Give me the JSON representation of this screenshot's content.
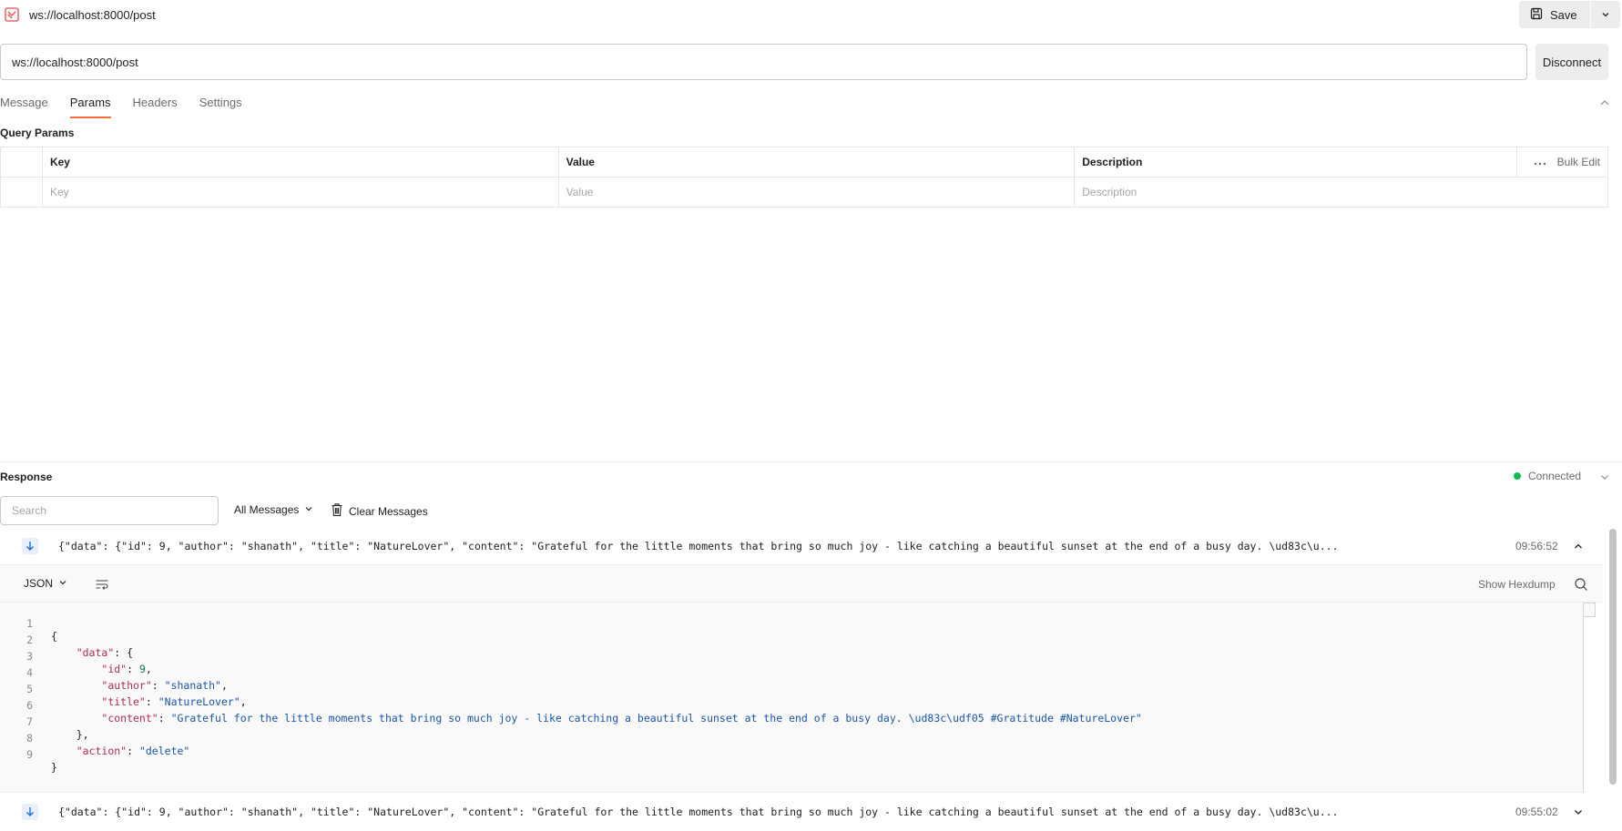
{
  "header": {
    "title": "ws://localhost:8000/post",
    "save_label": "Save"
  },
  "request": {
    "url": "ws://localhost:8000/post",
    "disconnect_label": "Disconnect",
    "tabs": [
      {
        "label": "Message"
      },
      {
        "label": "Params"
      },
      {
        "label": "Headers"
      },
      {
        "label": "Settings"
      }
    ],
    "active_tab": "Params"
  },
  "params": {
    "section_title": "Query Params",
    "columns": [
      "Key",
      "Value",
      "Description"
    ],
    "bulk_edit_label": "Bulk Edit",
    "placeholders": {
      "key": "Key",
      "value": "Value",
      "description": "Description"
    }
  },
  "response": {
    "section_title": "Response",
    "status": "Connected",
    "status_color": "#0cbb52",
    "search_placeholder": "Search",
    "filter_label": "All Messages",
    "clear_label": "Clear Messages",
    "messages": [
      {
        "direction": "incoming",
        "preview": "{\"data\": {\"id\": 9, \"author\": \"shanath\", \"title\": \"NatureLover\", \"content\": \"Grateful for the little moments that bring so much joy - like catching a beautiful sunset at the end of a busy day. \\ud83c\\u...",
        "time": "09:56:52",
        "expanded": true
      },
      {
        "direction": "incoming",
        "preview": "{\"data\": {\"id\": 9, \"author\": \"shanath\", \"title\": \"NatureLover\", \"content\": \"Grateful for the little moments that bring so much joy - like catching a beautiful sunset at the end of a busy day. \\ud83c\\u...",
        "time": "09:55:02",
        "expanded": false
      }
    ],
    "viewer": {
      "format": "JSON",
      "hexdump_label": "Show Hexdump",
      "line_numbers": [
        "1",
        "2",
        "3",
        "4",
        "5",
        "6",
        "7",
        "8",
        "9"
      ],
      "lines": [
        {
          "indent": "",
          "key": "",
          "value": "",
          "punct": "{"
        },
        {
          "indent": "    ",
          "key": "\"data\"",
          "value": "",
          "punct": ": {"
        },
        {
          "indent": "        ",
          "key": "\"id\"",
          "value": "9",
          "punct": ","
        },
        {
          "indent": "        ",
          "key": "\"author\"",
          "value": "\"shanath\"",
          "punct": ","
        },
        {
          "indent": "        ",
          "key": "\"title\"",
          "value": "\"NatureLover\"",
          "punct": ","
        },
        {
          "indent": "        ",
          "key": "\"content\"",
          "value": "\"Grateful for the little moments that bring so much joy - like catching a beautiful sunset at the end of a busy day. \\ud83c\\udf05 #Gratitude #NatureLover\"",
          "punct": ""
        },
        {
          "indent": "    ",
          "key": "",
          "value": "",
          "punct": "},"
        },
        {
          "indent": "    ",
          "key": "\"action\"",
          "value": "\"delete\"",
          "punct": ""
        },
        {
          "indent": "",
          "key": "",
          "value": "",
          "punct": "}"
        }
      ]
    }
  },
  "accent_color": "#ff6c37"
}
